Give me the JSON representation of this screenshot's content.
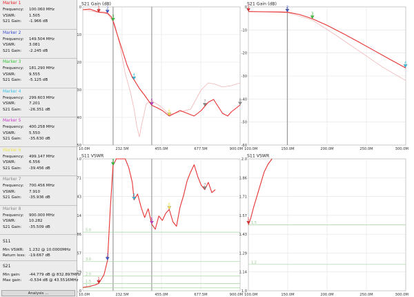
{
  "sidebar": {
    "markers": [
      {
        "title": "Marker 1",
        "color": "#e8262c",
        "rows": [
          {
            "label": "Frequency:",
            "value": "100.060 MHz"
          },
          {
            "label": "VSWR:",
            "value": "1.505"
          },
          {
            "label": "S21 Gain:",
            "value": "-1.966 dB"
          }
        ]
      },
      {
        "title": "Marker 2",
        "color": "#3b4fcf",
        "rows": [
          {
            "label": "Frequency:",
            "value": "149.504 MHz"
          },
          {
            "label": "VSWR:",
            "value": "3.081"
          },
          {
            "label": "S21 Gain:",
            "value": "-2.245 dB"
          }
        ]
      },
      {
        "title": "Marker 3",
        "color": "#35c235",
        "rows": [
          {
            "label": "Frequency:",
            "value": "181.290 MHz"
          },
          {
            "label": "VSWR:",
            "value": "9.555"
          },
          {
            "label": "S21 Gain:",
            "value": "-5.125 dB"
          }
        ]
      },
      {
        "title": "Marker 4",
        "color": "#36bfe6",
        "rows": [
          {
            "label": "Frequency:",
            "value": "299.603 MHz"
          },
          {
            "label": "VSWR:",
            "value": "7.201"
          },
          {
            "label": "S21 Gain:",
            "value": "-26.351 dB"
          }
        ]
      },
      {
        "title": "Marker 5",
        "color": "#c43bc4",
        "rows": [
          {
            "label": "Frequency:",
            "value": "400.258 MHz"
          },
          {
            "label": "VSWR:",
            "value": "5.550"
          },
          {
            "label": "S21 Gain:",
            "value": "-35.630 dB"
          }
        ]
      },
      {
        "title": "Marker 6",
        "color": "#efe34a",
        "rows": [
          {
            "label": "Frequency:",
            "value": "499.147 MHz"
          },
          {
            "label": "VSWR:",
            "value": "6.556"
          },
          {
            "label": "S21 Gain:",
            "value": "-39.456 dB"
          }
        ]
      },
      {
        "title": "Marker 7",
        "color": "#8a8a8a",
        "rows": [
          {
            "label": "Frequency:",
            "value": "700.456 MHz"
          },
          {
            "label": "VSWR:",
            "value": "7.910"
          },
          {
            "label": "S21 Gain:",
            "value": "-35.936 dB"
          }
        ]
      },
      {
        "title": "Marker 8",
        "color": "#8a8a8a",
        "rows": [
          {
            "label": "Frequency:",
            "value": "900.000 MHz"
          },
          {
            "label": "VSWR:",
            "value": "10.282"
          },
          {
            "label": "S21 Gain:",
            "value": "-35.509 dB"
          }
        ]
      }
    ],
    "s11": {
      "title": "S11",
      "min_vswr_label": "Min VSWR:",
      "min_vswr_value": "1.232 @ 10.0000MHz",
      "return_loss_label": "Return loss:",
      "return_loss_value": "-19.667 dB"
    },
    "s21": {
      "title": "S21",
      "min_gain_label": "Min gain:",
      "min_gain_value": "-44.779 dB @ 832.897MHz",
      "max_gain_label": "Max gain:",
      "max_gain_value": "-0.534 dB @ 43.5516MHz"
    },
    "analyze_button": "Analysis ..."
  },
  "chart_data": [
    {
      "id": "s21-wide",
      "type": "line",
      "title": "S21 Gain (dB)",
      "x_ticks": [
        "10.0M",
        "232.5M",
        "455.0M",
        "677.5M",
        "900.0M"
      ],
      "y_ticks": [
        "0",
        "-10",
        "-20",
        "-30",
        "-40",
        "-50"
      ],
      "xlim": [
        10,
        900
      ],
      "ylim": [
        -50,
        0
      ],
      "series": [
        {
          "color": "#e83030",
          "points": [
            [
              10,
              -1.0
            ],
            [
              50,
              -0.8
            ],
            [
              100,
              -1.9
            ],
            [
              130,
              -2.0
            ],
            [
              150,
              -2.3
            ],
            [
              170,
              -3.5
            ],
            [
              181,
              -5.1
            ],
            [
              200,
              -9
            ],
            [
              230,
              -15
            ],
            [
              260,
              -21
            ],
            [
              290,
              -25.5
            ],
            [
              300,
              -26.4
            ],
            [
              330,
              -29.5
            ],
            [
              360,
              -32
            ],
            [
              400,
              -35.6
            ],
            [
              430,
              -36.5
            ],
            [
              460,
              -37.5
            ],
            [
              499,
              -39.5
            ],
            [
              530,
              -38.5
            ],
            [
              560,
              -37.5
            ],
            [
              600,
              -38.5
            ],
            [
              640,
              -39.5
            ],
            [
              680,
              -37.5
            ],
            [
              700,
              -36
            ],
            [
              720,
              -34.5
            ],
            [
              750,
              -33.5
            ],
            [
              780,
              -36.5
            ],
            [
              800,
              -38.5
            ],
            [
              830,
              -39.5
            ],
            [
              850,
              -38
            ],
            [
              870,
              -37
            ],
            [
              900,
              -35.5
            ]
          ]
        },
        {
          "color": "#f2b4b4",
          "points": [
            [
              10,
              -1.0
            ],
            [
              100,
              -2.0
            ],
            [
              150,
              -2.5
            ],
            [
              190,
              -6
            ],
            [
              220,
              -14
            ],
            [
              250,
              -24
            ],
            [
              280,
              -31
            ],
            [
              300,
              -37
            ],
            [
              315,
              -43
            ],
            [
              330,
              -47
            ],
            [
              345,
              -42
            ],
            [
              370,
              -35
            ],
            [
              400,
              -34
            ],
            [
              450,
              -36
            ],
            [
              500,
              -39
            ],
            [
              560,
              -38
            ],
            [
              620,
              -37
            ],
            [
              680,
              -30
            ],
            [
              720,
              -27.5
            ],
            [
              760,
              -28
            ],
            [
              800,
              -29
            ],
            [
              850,
              -28.5
            ],
            [
              900,
              -27.5
            ]
          ]
        }
      ],
      "markers": [
        {
          "label": "1",
          "x": 100.06,
          "y": -1.966,
          "color": "#e8262c"
        },
        {
          "label": "2",
          "x": 149.5,
          "y": -2.245,
          "color": "#3b4fcf"
        },
        {
          "label": "3",
          "x": 181.29,
          "y": -5.125,
          "color": "#35c235"
        },
        {
          "label": "4",
          "x": 299.6,
          "y": -26.351,
          "color": "#36bfe6"
        },
        {
          "label": "5",
          "x": 400.26,
          "y": -35.63,
          "color": "#c43bc4"
        },
        {
          "label": "6",
          "x": 499.15,
          "y": -39.456,
          "color": "#efe34a"
        },
        {
          "label": "7",
          "x": 700.46,
          "y": -35.936,
          "color": "#8a8a8a"
        },
        {
          "label": "8",
          "x": 900,
          "y": -35.509,
          "color": "#8a8a8a"
        }
      ]
    },
    {
      "id": "s21-zoom",
      "type": "line",
      "title": "S21 Gain (dB)",
      "x_ticks": [
        "100.0M",
        "150.0M",
        "200.0M",
        "250.0M",
        "300.0M"
      ],
      "y_ticks": [
        "0",
        "-10",
        "-20",
        "-30",
        "-40",
        "-50",
        "-60"
      ],
      "xlim": [
        100,
        300
      ],
      "ylim": [
        -60,
        0
      ],
      "series": [
        {
          "color": "#e83030",
          "points": [
            [
              100,
              -2.0
            ],
            [
              120,
              -2.1
            ],
            [
              140,
              -2.2
            ],
            [
              150,
              -2.3
            ],
            [
              165,
              -3.3
            ],
            [
              181,
              -5.1
            ],
            [
              200,
              -8
            ],
            [
              220,
              -11.5
            ],
            [
              240,
              -15.2
            ],
            [
              260,
              -19
            ],
            [
              280,
              -22.8
            ],
            [
              300,
              -26.5
            ]
          ]
        },
        {
          "color": "#f2b4b4",
          "points": [
            [
              100,
              -2.0
            ],
            [
              150,
              -2.5
            ],
            [
              180,
              -5.5
            ],
            [
              210,
              -12
            ],
            [
              240,
              -19
            ],
            [
              270,
              -26
            ],
            [
              300,
              -32
            ]
          ]
        }
      ],
      "markers": [
        {
          "label": "1",
          "x": 100.06,
          "y": -1.966,
          "color": "#e8262c"
        },
        {
          "label": "2",
          "x": 149.5,
          "y": -2.245,
          "color": "#3b4fcf"
        },
        {
          "label": "3",
          "x": 181.29,
          "y": -5.125,
          "color": "#35c235"
        },
        {
          "label": "4",
          "x": 299.6,
          "y": -26.351,
          "color": "#36bfe6"
        }
      ]
    },
    {
      "id": "s11-wide",
      "type": "line",
      "title": "S11 VSWR",
      "x_ticks": [
        "10.0M",
        "232.5M",
        "455.0M",
        "677.5M",
        "900.0M"
      ],
      "y_ticks": [
        "10.0",
        "8.71",
        "7.43",
        "6.14",
        "4.86",
        "3.57",
        "2.29",
        "1.0"
      ],
      "xlim": [
        10,
        900
      ],
      "ylim": [
        1,
        10
      ],
      "series": [
        {
          "color": "#e83030",
          "points": [
            [
              10,
              1.23
            ],
            [
              50,
              1.3
            ],
            [
              80,
              1.4
            ],
            [
              100,
              1.5
            ],
            [
              130,
              2.1
            ],
            [
              150,
              3.08
            ],
            [
              165,
              6.5
            ],
            [
              181,
              9.55
            ],
            [
              200,
              10
            ],
            [
              250,
              10
            ],
            [
              270,
              9.4
            ],
            [
              290,
              8.4
            ],
            [
              300,
              7.2
            ],
            [
              320,
              7.6
            ],
            [
              340,
              6.7
            ],
            [
              360,
              6.0
            ],
            [
              380,
              6.6
            ],
            [
              400,
              5.55
            ],
            [
              420,
              5.2
            ],
            [
              440,
              6.1
            ],
            [
              460,
              5.8
            ],
            [
              480,
              6.3
            ],
            [
              499,
              6.55
            ],
            [
              520,
              5.7
            ],
            [
              540,
              5.4
            ],
            [
              560,
              6.7
            ],
            [
              580,
              7.5
            ],
            [
              600,
              8.5
            ],
            [
              620,
              9.1
            ],
            [
              640,
              9.6
            ],
            [
              660,
              8.8
            ],
            [
              680,
              8.2
            ],
            [
              700,
              7.9
            ],
            [
              720,
              8.4
            ],
            [
              740,
              7.7
            ],
            [
              760,
              7.9
            ]
          ]
        }
      ],
      "reference_lines": [
        {
          "label": "5.0",
          "value": 5.0
        },
        {
          "label": "3.0",
          "value": 3.0
        },
        {
          "label": "2.0",
          "value": 2.0
        },
        {
          "label": "1.5",
          "value": 1.5
        },
        {
          "label": "1.2",
          "value": 1.2
        }
      ],
      "markers": [
        {
          "label": "1",
          "x": 100.06,
          "y": 1.505,
          "color": "#e8262c"
        },
        {
          "label": "2",
          "x": 149.5,
          "y": 3.081,
          "color": "#3b4fcf"
        },
        {
          "label": "3",
          "x": 181.29,
          "y": 9.555,
          "color": "#35c235"
        },
        {
          "label": "4",
          "x": 299.6,
          "y": 7.201,
          "color": "#36bfe6"
        },
        {
          "label": "5",
          "x": 400.26,
          "y": 5.55,
          "color": "#c43bc4"
        },
        {
          "label": "6",
          "x": 499.15,
          "y": 6.556,
          "color": "#efe34a"
        },
        {
          "label": "7",
          "x": 700.46,
          "y": 7.91,
          "color": "#8a8a8a"
        }
      ]
    },
    {
      "id": "s11-zoom",
      "type": "line",
      "title": "S11 VSWR",
      "x_ticks": [
        "100.0M",
        "150.0M",
        "200.0M",
        "250.0M",
        "300.0M"
      ],
      "y_ticks": [
        "2.0",
        "1.86",
        "1.71",
        "1.57",
        "1.43",
        "1.29",
        "1.14",
        "1.0"
      ],
      "xlim": [
        100,
        300
      ],
      "ylim": [
        1,
        2
      ],
      "series": [
        {
          "color": "#e83030",
          "points": [
            [
              100,
              1.5
            ],
            [
              103,
              1.55
            ],
            [
              106,
              1.62
            ],
            [
              110,
              1.7
            ],
            [
              115,
              1.8
            ],
            [
              120,
              1.9
            ],
            [
              125,
              1.96
            ],
            [
              130,
              2.0
            ]
          ]
        }
      ],
      "reference_lines": [
        {
          "label": "1.5",
          "value": 1.5
        },
        {
          "label": "1.2",
          "value": 1.2
        }
      ],
      "markers": [
        {
          "label": "1",
          "x": 100.06,
          "y": 1.505,
          "color": "#e8262c"
        }
      ]
    }
  ]
}
